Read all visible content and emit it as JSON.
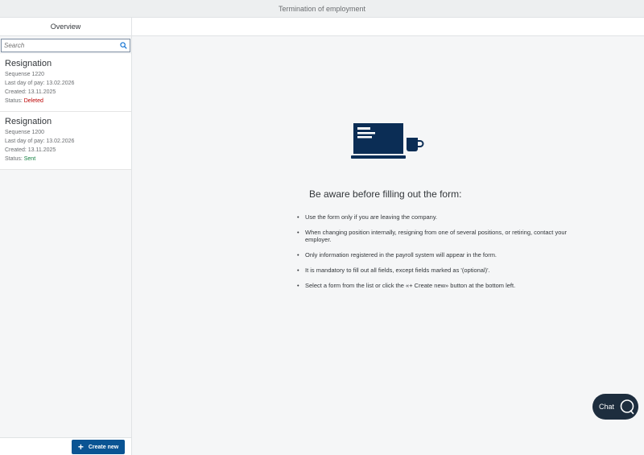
{
  "app": {
    "title": "Termination of employment"
  },
  "left": {
    "header": "Overview",
    "search": {
      "placeholder": "Search",
      "value": ""
    },
    "items": [
      {
        "title": "Resignation",
        "sequence": "Sequense 1220",
        "last_day": "Last day of pay: 13.02.2026",
        "created": "Created: 13.11.2025",
        "status_label": "Status: ",
        "status_value": "Deleted",
        "status_color": "#bb0000"
      },
      {
        "title": "Resignation",
        "sequence": "Sequense 1200",
        "last_day": "Last day of pay: 13.02.2026",
        "created": "Created: 13.11.2025",
        "status_label": "Status: ",
        "status_value": "Sent",
        "status_color": "#107e3e"
      }
    ],
    "create_label": "Create new"
  },
  "main": {
    "heading": "Be aware before filling out the form:",
    "bullets": [
      "Use the form only if you are leaving the company.",
      "When changing position internally, resigning from one of several positions, or retiring, contact your employer.",
      "Only information registered in the payroll system will appear in the form.",
      "It is mandatory to fill out all fields, except fields marked as '(optional)'.",
      "Select a form from the list or click the «+ Create new» button at the bottom left."
    ]
  },
  "chat": {
    "label": "Chat"
  },
  "colors": {
    "accent": "#0a5493",
    "chat_bg": "#1d2d3e",
    "illustration": "#0b2d55"
  },
  "icons": {
    "search": "search-icon",
    "plus": "plus-icon",
    "chat": "chat-bubble-icon",
    "illustration": "laptop-coffee-illustration"
  }
}
